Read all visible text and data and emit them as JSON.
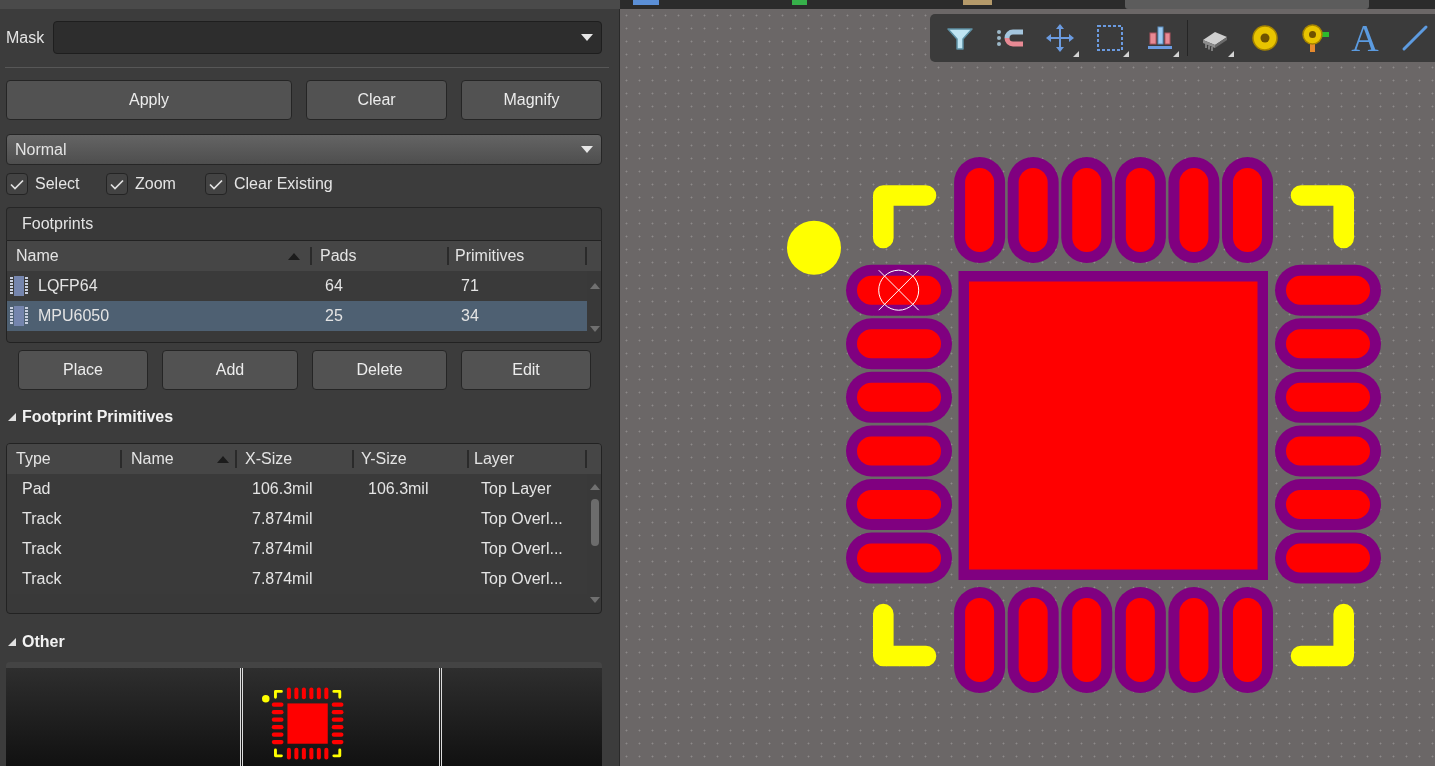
{
  "panel": {
    "mask": {
      "label": "Mask"
    },
    "actions": [
      "Apply",
      "Clear",
      "Magnify"
    ],
    "mode": {
      "value": "Normal"
    },
    "options": [
      {
        "label": "Select",
        "checked": true
      },
      {
        "label": "Zoom",
        "checked": true
      },
      {
        "label": "Clear Existing",
        "checked": true
      }
    ],
    "footprints": {
      "title": "Footprints",
      "columns": [
        {
          "label": "Name",
          "sorted": true
        },
        {
          "label": "Pads",
          "sorted": false
        },
        {
          "label": "Primitives",
          "sorted": false
        }
      ],
      "rows": [
        {
          "name": "LQFP64",
          "pads": "64",
          "primitives": "71",
          "selected": false
        },
        {
          "name": "MPU6050",
          "pads": "25",
          "primitives": "34",
          "selected": true
        }
      ],
      "buttons": [
        "Place",
        "Add",
        "Delete",
        "Edit"
      ]
    },
    "primitives": {
      "title": "Footprint Primitives",
      "expanded": true,
      "columns": [
        {
          "label": "Type",
          "sorted": false
        },
        {
          "label": "Name",
          "sorted": true
        },
        {
          "label": "X-Size",
          "sorted": false
        },
        {
          "label": "Y-Size",
          "sorted": false
        },
        {
          "label": "Layer",
          "sorted": false
        }
      ],
      "rows": [
        {
          "type": "Pad",
          "x_size": "106.3mil",
          "y_size": "106.3mil",
          "layer": "Top Layer",
          "selected": false
        },
        {
          "type": "Track",
          "x_size": "7.874mil",
          "layer": "Top Overl...",
          "selected": false
        },
        {
          "type": "Track",
          "x_size": "7.874mil",
          "layer": "Top Overl...",
          "selected": false
        },
        {
          "type": "Track",
          "x_size": "7.874mil",
          "layer": "Top Overl...",
          "selected": false
        }
      ]
    },
    "other": {
      "title": "Other",
      "expanded": true
    }
  },
  "toolbar": {
    "groups": [
      [
        {
          "kind": "filter",
          "submenu": false
        },
        {
          "kind": "snap",
          "submenu": false
        },
        {
          "kind": "move",
          "submenu": true
        },
        {
          "kind": "select",
          "submenu": true
        },
        {
          "kind": "align",
          "submenu": true
        }
      ],
      [
        {
          "kind": "component",
          "submenu": true
        },
        {
          "kind": "via",
          "submenu": false
        },
        {
          "kind": "pad",
          "submenu": false
        },
        {
          "kind": "text",
          "glyph": "A",
          "submenu": false
        },
        {
          "kind": "line",
          "submenu": false
        }
      ]
    ]
  }
}
